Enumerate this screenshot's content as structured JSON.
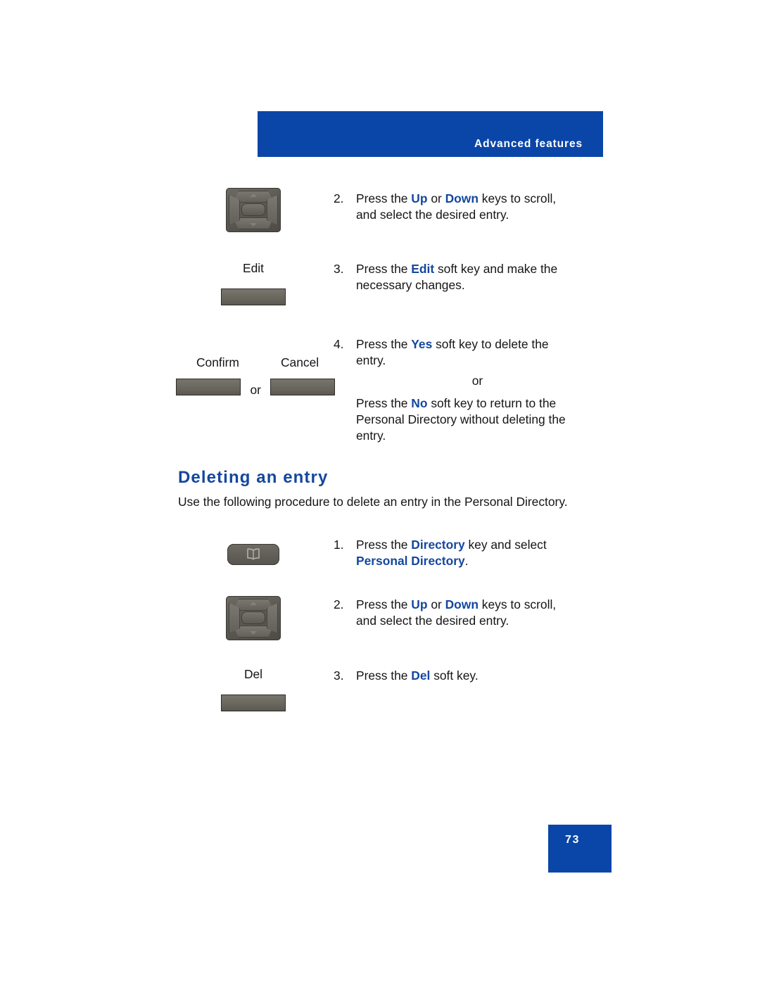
{
  "header": {
    "title": "Advanced features"
  },
  "continued_procedure": {
    "steps": [
      {
        "number": "2.",
        "art": "navigation-key",
        "art_label": "",
        "lines": [
          [
            {
              "t": "Press the ",
              "b": false
            },
            {
              "t": "Up",
              "b": true
            },
            {
              "t": " or ",
              "b": false
            },
            {
              "t": "Down",
              "b": true
            },
            {
              "t": " keys to scroll,",
              "b": false
            }
          ],
          [
            {
              "t": "and select the desired entry.",
              "b": false
            }
          ]
        ]
      },
      {
        "number": "3.",
        "art": "soft-key",
        "art_label": "Edit",
        "lines": [
          [
            {
              "t": "Press the ",
              "b": false
            },
            {
              "t": "Edit",
              "b": true
            },
            {
              "t": " soft key and make the",
              "b": false
            }
          ],
          [
            {
              "t": "necessary changes.",
              "b": false
            }
          ]
        ]
      },
      {
        "number": "4.",
        "art": "soft-key-pair",
        "art_label_left": "Confirm",
        "art_label_right": "Cancel",
        "art_separator": "or",
        "lines": [
          [
            {
              "t": "Press the ",
              "b": false
            },
            {
              "t": "Yes",
              "b": true
            },
            {
              "t": " soft key to delete the",
              "b": false
            }
          ],
          [
            {
              "t": "entry.",
              "b": false
            }
          ]
        ],
        "or_separator": "or",
        "alt_lines": [
          [
            {
              "t": "Press the ",
              "b": false
            },
            {
              "t": "No",
              "b": true
            },
            {
              "t": " soft key to return to the",
              "b": false
            }
          ],
          [
            {
              "t": "Personal Directory without deleting the",
              "b": false
            }
          ],
          [
            {
              "t": "entry.",
              "b": false
            }
          ]
        ]
      }
    ]
  },
  "section": {
    "heading": "Deleting an entry",
    "intro": "Use the following procedure to delete an entry in the Personal Directory.",
    "steps": [
      {
        "number": "1.",
        "art": "directory-key",
        "art_label": "",
        "lines": [
          [
            {
              "t": "Press the ",
              "b": false
            },
            {
              "t": "Directory",
              "b": true
            },
            {
              "t": " key and select",
              "b": false
            }
          ],
          [
            {
              "t": "Personal Directory",
              "b": true
            },
            {
              "t": ".",
              "b": false
            }
          ]
        ]
      },
      {
        "number": "2.",
        "art": "navigation-key",
        "art_label": "",
        "lines": [
          [
            {
              "t": "Press the ",
              "b": false
            },
            {
              "t": "Up",
              "b": true
            },
            {
              "t": " or ",
              "b": false
            },
            {
              "t": "Down",
              "b": true
            },
            {
              "t": " keys to scroll,",
              "b": false
            }
          ],
          [
            {
              "t": "and select the desired entry.",
              "b": false
            }
          ]
        ]
      },
      {
        "number": "3.",
        "art": "soft-key",
        "art_label": "Del",
        "lines": [
          [
            {
              "t": "Press the ",
              "b": false
            },
            {
              "t": "Del",
              "b": true
            },
            {
              "t": " soft key.",
              "b": false
            }
          ]
        ]
      }
    ]
  },
  "footer": {
    "page_number": "73"
  },
  "colors": {
    "brand_blue": "#0A46A8",
    "keyword_blue": "#14479E",
    "text_black": "#151515"
  }
}
